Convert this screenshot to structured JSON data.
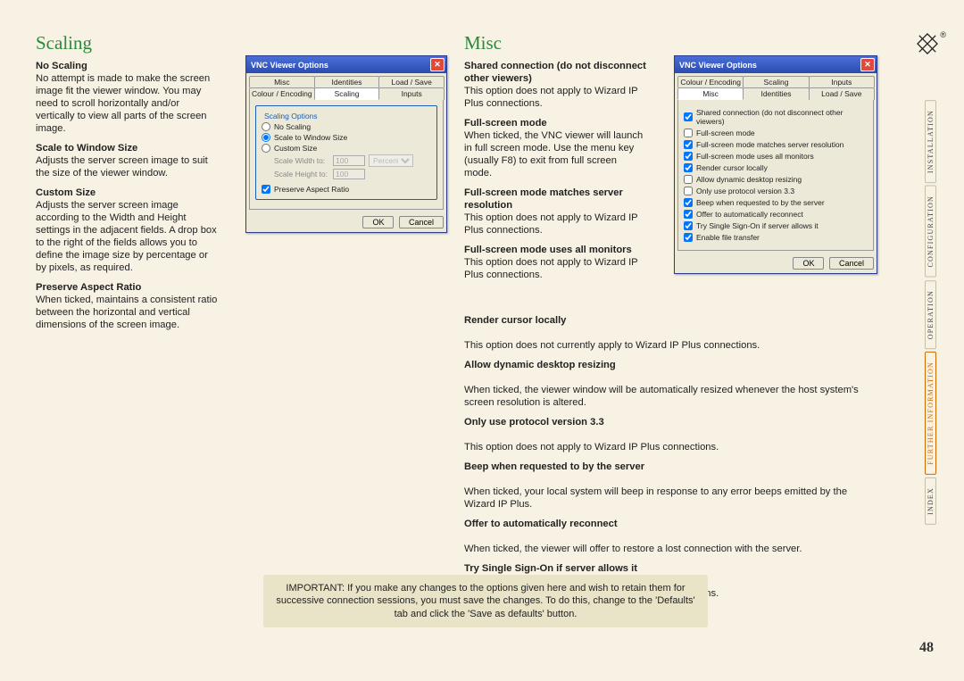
{
  "page_number": "48",
  "sections": {
    "scaling": {
      "title": "Scaling",
      "options": [
        {
          "title": "No Scaling",
          "body": "No attempt is made to make the screen image fit the viewer window. You may need to scroll horizontally and/or vertically to view all parts of the screen image."
        },
        {
          "title": "Scale to Window Size",
          "body": "Adjusts the server screen image to suit the size of the viewer window."
        },
        {
          "title": "Custom Size",
          "body": "Adjusts the server screen image according to the Width and Height settings in the adjacent fields. A drop box to the right of the fields allows you to define the image size by percentage or by pixels, as required."
        },
        {
          "title": "Preserve Aspect Ratio",
          "body": "When ticked, maintains a consistent ratio between the horizontal and vertical dimensions of the screen image."
        }
      ]
    },
    "misc": {
      "title": "Misc",
      "options_top": [
        {
          "title": "Shared connection (do not dis­connect other viewers)",
          "body": "This option does not apply to Wizard IP Plus connections."
        },
        {
          "title": "Full-screen mode",
          "body": "When ticked, the VNC viewer will launch in full screen mode. Use the menu key (usually F8) to exit from full screen mode."
        },
        {
          "title": "Full-screen mode matches server resolution",
          "body": "This option does not apply to Wizard IP Plus connections."
        },
        {
          "title": "Full-screen mode uses all monitors",
          "body": "This option does not apply to Wizard IP Plus connections."
        }
      ],
      "options_wide": [
        {
          "title": "Render cursor locally",
          "body": "This option does not currently apply to Wizard IP Plus connections."
        },
        {
          "title": "Allow dynamic desktop resizing",
          "body": "When ticked, the viewer window will be automatically resized whenever the host system's screen resolution is altered."
        },
        {
          "title": "Only use protocol version 3.3",
          "body": "This option does not apply to Wizard IP Plus connections."
        },
        {
          "title": "Beep when requested to by the server",
          "body": "When ticked, your local system will beep in response to any error beeps emitted by the Wizard IP Plus."
        },
        {
          "title": "Offer to automatically reconnect",
          "body": "When ticked, the viewer will offer to restore a lost connection with the server."
        },
        {
          "title": "Try Single Sign-On if server allows it",
          "body": "This option does not apply to Wizard IP Plus connections."
        }
      ]
    }
  },
  "dialog_scaling": {
    "title": "VNC Viewer Options",
    "tabs_row1": [
      "Misc",
      "Identities",
      "Load / Save"
    ],
    "tabs_row2": [
      "Colour / Encoding",
      "Scaling",
      "Inputs"
    ],
    "active_tab": "Scaling",
    "group_title": "Scaling Options",
    "radios": [
      {
        "label": "No Scaling",
        "checked": false
      },
      {
        "label": "Scale to Window Size",
        "checked": true
      },
      {
        "label": "Custom Size",
        "checked": false
      }
    ],
    "width_label": "Scale Width to:",
    "width_value": "100",
    "height_label": "Scale Height to:",
    "height_value": "100",
    "unit": "Percent",
    "preserve": {
      "label": "Preserve Aspect Ratio",
      "checked": true
    },
    "ok": "OK",
    "cancel": "Cancel"
  },
  "dialog_misc": {
    "title": "VNC Viewer Options",
    "tabs_row1": [
      "Colour / Encoding",
      "Scaling",
      "Inputs"
    ],
    "tabs_row2": [
      "Misc",
      "Identities",
      "Load / Save"
    ],
    "active_tab": "Misc",
    "checks": [
      {
        "label": "Shared connection (do not disconnect other viewers)",
        "checked": true
      },
      {
        "label": "Full-screen mode",
        "checked": false
      },
      {
        "label": "Full-screen mode matches server resolution",
        "checked": true
      },
      {
        "label": "Full-screen mode uses all monitors",
        "checked": true
      },
      {
        "label": "Render cursor locally",
        "checked": true
      },
      {
        "label": "Allow dynamic desktop resizing",
        "checked": false
      },
      {
        "label": "Only use protocol version 3.3",
        "checked": false
      },
      {
        "label": "Beep when requested to by the server",
        "checked": true
      },
      {
        "label": "Offer to automatically reconnect",
        "checked": true
      },
      {
        "label": "Try Single Sign-On if server allows it",
        "checked": true
      },
      {
        "label": "Enable file transfer",
        "checked": true
      }
    ],
    "ok": "OK",
    "cancel": "Cancel"
  },
  "important": "IMPORTANT: If you make any changes to the options given here and wish to retain them for successive connection sessions, you must save the changes. To do this, change to the 'Defaults' tab and click the 'Save as defaults' button.",
  "side_tabs": [
    "INSTALLATION",
    "CONFIGURATION",
    "OPERATION",
    "FURTHER INFORMATION",
    "INDEX"
  ],
  "side_active": "FURTHER INFORMATION"
}
